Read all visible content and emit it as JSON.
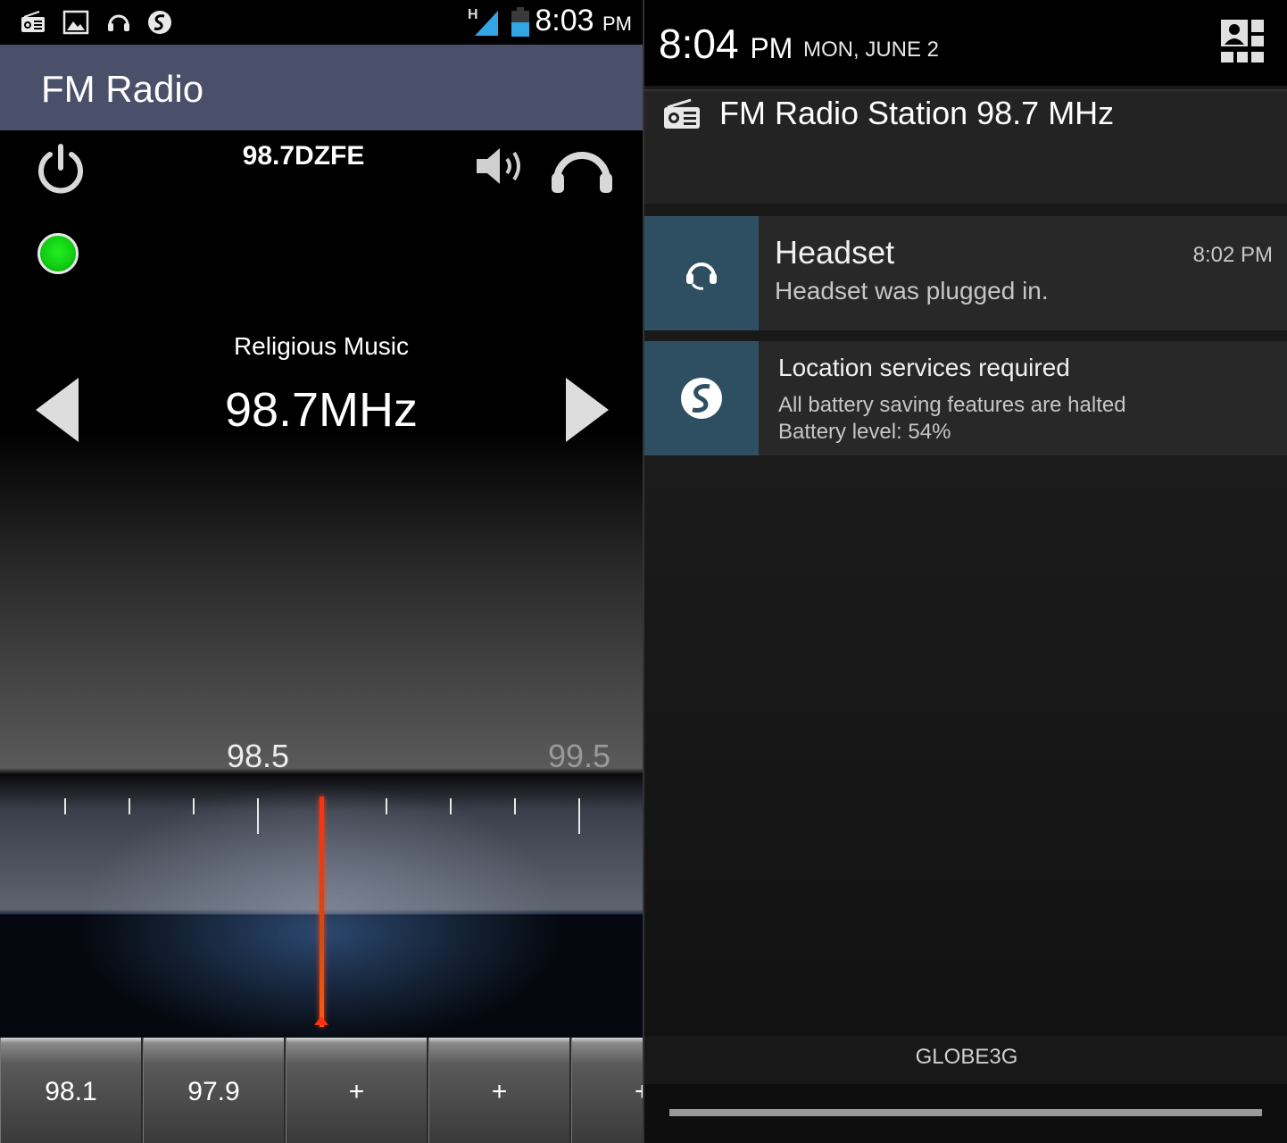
{
  "left": {
    "status_bar": {
      "icons": [
        "radio-icon",
        "image-icon",
        "headset-icon",
        "s-app-icon",
        "signal-icon",
        "battery-icon"
      ],
      "network": "H",
      "time": "8:03",
      "ampm": "PM"
    },
    "app_title": "FM Radio",
    "station_id": "98.7DZFE",
    "genre": "Religious Music",
    "frequency": "98.7MHz",
    "scale_labels": [
      "98.5",
      "99.5"
    ],
    "presets": [
      "98.1",
      "97.9",
      "+",
      "+",
      "+"
    ],
    "colors": {
      "appbar": "#4a4f6a",
      "led": "#11cc11",
      "needle": "#ff3010"
    }
  },
  "right": {
    "header": {
      "time": "8:04",
      "ampm": "PM",
      "date": "MON, JUNE 2"
    },
    "radio_notification": {
      "title": "FM Radio Station 98.7 MHz"
    },
    "headset_notification": {
      "title": "Headset",
      "time": "8:02 PM",
      "text": "Headset was plugged in."
    },
    "location_notification": {
      "title": "Location services required",
      "line1": "All battery saving features are halted",
      "line2": "Battery level: 54%"
    },
    "carrier": "GLOBE3G",
    "colors": {
      "notif_icon_bg": "#2e4f62"
    }
  }
}
